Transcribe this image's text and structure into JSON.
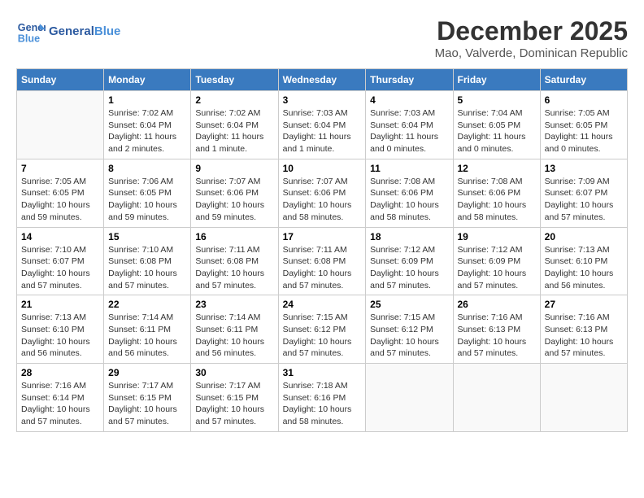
{
  "header": {
    "logo_general": "General",
    "logo_blue": "Blue",
    "month_title": "December 2025",
    "location": "Mao, Valverde, Dominican Republic"
  },
  "weekdays": [
    "Sunday",
    "Monday",
    "Tuesday",
    "Wednesday",
    "Thursday",
    "Friday",
    "Saturday"
  ],
  "weeks": [
    [
      {
        "day": "",
        "info": ""
      },
      {
        "day": "1",
        "info": "Sunrise: 7:02 AM\nSunset: 6:04 PM\nDaylight: 11 hours\nand 2 minutes."
      },
      {
        "day": "2",
        "info": "Sunrise: 7:02 AM\nSunset: 6:04 PM\nDaylight: 11 hours\nand 1 minute."
      },
      {
        "day": "3",
        "info": "Sunrise: 7:03 AM\nSunset: 6:04 PM\nDaylight: 11 hours\nand 1 minute."
      },
      {
        "day": "4",
        "info": "Sunrise: 7:03 AM\nSunset: 6:04 PM\nDaylight: 11 hours\nand 0 minutes."
      },
      {
        "day": "5",
        "info": "Sunrise: 7:04 AM\nSunset: 6:05 PM\nDaylight: 11 hours\nand 0 minutes."
      },
      {
        "day": "6",
        "info": "Sunrise: 7:05 AM\nSunset: 6:05 PM\nDaylight: 11 hours\nand 0 minutes."
      }
    ],
    [
      {
        "day": "7",
        "info": "Sunrise: 7:05 AM\nSunset: 6:05 PM\nDaylight: 10 hours\nand 59 minutes."
      },
      {
        "day": "8",
        "info": "Sunrise: 7:06 AM\nSunset: 6:05 PM\nDaylight: 10 hours\nand 59 minutes."
      },
      {
        "day": "9",
        "info": "Sunrise: 7:07 AM\nSunset: 6:06 PM\nDaylight: 10 hours\nand 59 minutes."
      },
      {
        "day": "10",
        "info": "Sunrise: 7:07 AM\nSunset: 6:06 PM\nDaylight: 10 hours\nand 58 minutes."
      },
      {
        "day": "11",
        "info": "Sunrise: 7:08 AM\nSunset: 6:06 PM\nDaylight: 10 hours\nand 58 minutes."
      },
      {
        "day": "12",
        "info": "Sunrise: 7:08 AM\nSunset: 6:06 PM\nDaylight: 10 hours\nand 58 minutes."
      },
      {
        "day": "13",
        "info": "Sunrise: 7:09 AM\nSunset: 6:07 PM\nDaylight: 10 hours\nand 57 minutes."
      }
    ],
    [
      {
        "day": "14",
        "info": "Sunrise: 7:10 AM\nSunset: 6:07 PM\nDaylight: 10 hours\nand 57 minutes."
      },
      {
        "day": "15",
        "info": "Sunrise: 7:10 AM\nSunset: 6:08 PM\nDaylight: 10 hours\nand 57 minutes."
      },
      {
        "day": "16",
        "info": "Sunrise: 7:11 AM\nSunset: 6:08 PM\nDaylight: 10 hours\nand 57 minutes."
      },
      {
        "day": "17",
        "info": "Sunrise: 7:11 AM\nSunset: 6:08 PM\nDaylight: 10 hours\nand 57 minutes."
      },
      {
        "day": "18",
        "info": "Sunrise: 7:12 AM\nSunset: 6:09 PM\nDaylight: 10 hours\nand 57 minutes."
      },
      {
        "day": "19",
        "info": "Sunrise: 7:12 AM\nSunset: 6:09 PM\nDaylight: 10 hours\nand 57 minutes."
      },
      {
        "day": "20",
        "info": "Sunrise: 7:13 AM\nSunset: 6:10 PM\nDaylight: 10 hours\nand 56 minutes."
      }
    ],
    [
      {
        "day": "21",
        "info": "Sunrise: 7:13 AM\nSunset: 6:10 PM\nDaylight: 10 hours\nand 56 minutes."
      },
      {
        "day": "22",
        "info": "Sunrise: 7:14 AM\nSunset: 6:11 PM\nDaylight: 10 hours\nand 56 minutes."
      },
      {
        "day": "23",
        "info": "Sunrise: 7:14 AM\nSunset: 6:11 PM\nDaylight: 10 hours\nand 56 minutes."
      },
      {
        "day": "24",
        "info": "Sunrise: 7:15 AM\nSunset: 6:12 PM\nDaylight: 10 hours\nand 57 minutes."
      },
      {
        "day": "25",
        "info": "Sunrise: 7:15 AM\nSunset: 6:12 PM\nDaylight: 10 hours\nand 57 minutes."
      },
      {
        "day": "26",
        "info": "Sunrise: 7:16 AM\nSunset: 6:13 PM\nDaylight: 10 hours\nand 57 minutes."
      },
      {
        "day": "27",
        "info": "Sunrise: 7:16 AM\nSunset: 6:13 PM\nDaylight: 10 hours\nand 57 minutes."
      }
    ],
    [
      {
        "day": "28",
        "info": "Sunrise: 7:16 AM\nSunset: 6:14 PM\nDaylight: 10 hours\nand 57 minutes."
      },
      {
        "day": "29",
        "info": "Sunrise: 7:17 AM\nSunset: 6:15 PM\nDaylight: 10 hours\nand 57 minutes."
      },
      {
        "day": "30",
        "info": "Sunrise: 7:17 AM\nSunset: 6:15 PM\nDaylight: 10 hours\nand 57 minutes."
      },
      {
        "day": "31",
        "info": "Sunrise: 7:18 AM\nSunset: 6:16 PM\nDaylight: 10 hours\nand 58 minutes."
      },
      {
        "day": "",
        "info": ""
      },
      {
        "day": "",
        "info": ""
      },
      {
        "day": "",
        "info": ""
      }
    ]
  ]
}
